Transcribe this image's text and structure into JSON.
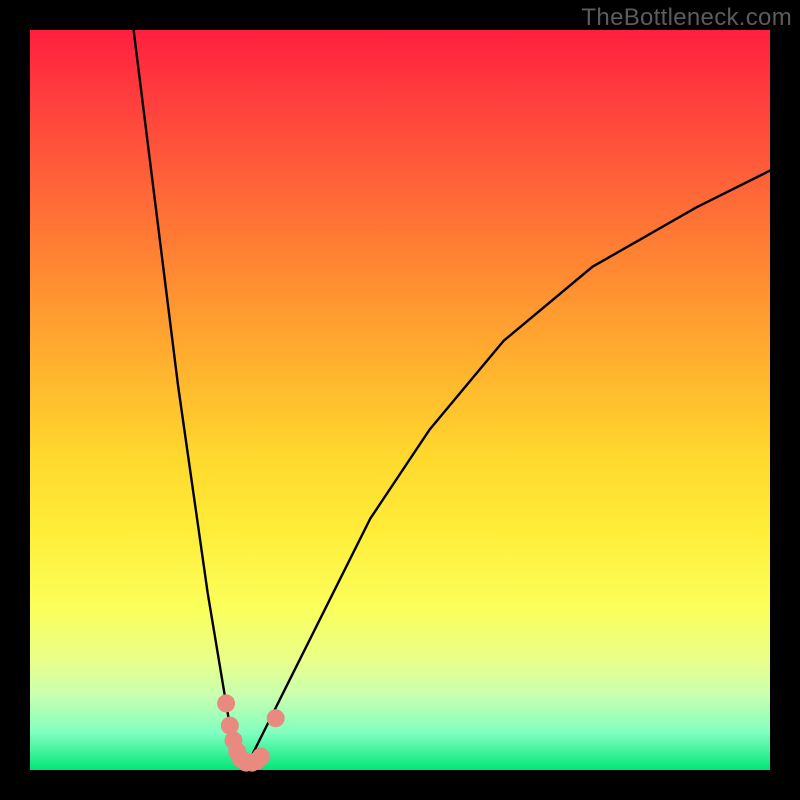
{
  "watermark": "TheBottleneck.com",
  "chart_data": {
    "type": "line",
    "title": "",
    "xlabel": "",
    "ylabel": "",
    "xlim": [
      0,
      100
    ],
    "ylim": [
      0,
      100
    ],
    "grid": false,
    "legend": false,
    "series": [
      {
        "name": "bottleneck-curve-left",
        "x": [
          14,
          16,
          18,
          20,
          22,
          24,
          26,
          27,
          28,
          29
        ],
        "y": [
          100,
          84,
          68,
          52,
          38,
          24,
          12,
          6,
          2,
          0
        ]
      },
      {
        "name": "bottleneck-curve-right",
        "x": [
          29,
          30,
          32,
          35,
          40,
          46,
          54,
          64,
          76,
          90,
          100
        ],
        "y": [
          0,
          2,
          6,
          12,
          22,
          34,
          46,
          58,
          68,
          76,
          81
        ]
      }
    ],
    "markers": {
      "name": "highlight-points",
      "color": "#e88a80",
      "points": [
        {
          "x": 26.5,
          "y": 9
        },
        {
          "x": 27.0,
          "y": 6
        },
        {
          "x": 27.5,
          "y": 4
        },
        {
          "x": 28.0,
          "y": 2.5
        },
        {
          "x": 28.5,
          "y": 1.5
        },
        {
          "x": 29.2,
          "y": 1
        },
        {
          "x": 30.0,
          "y": 1
        },
        {
          "x": 30.6,
          "y": 1.2
        },
        {
          "x": 31.2,
          "y": 1.8
        },
        {
          "x": 33.2,
          "y": 7
        }
      ]
    }
  }
}
